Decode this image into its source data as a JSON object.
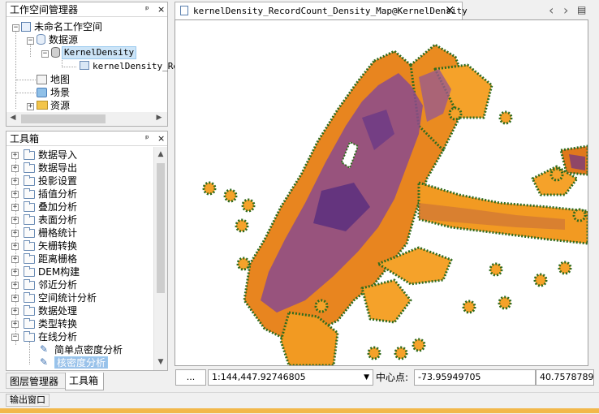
{
  "workspace_panel": {
    "title": "工作空间管理器",
    "pin": "ᵖ",
    "close": "×",
    "items": [
      {
        "label": "未命名工作空间"
      },
      {
        "label": "数据源"
      },
      {
        "label": "KernelDensity"
      },
      {
        "label": "kernelDensity_Re"
      },
      {
        "label": "地图"
      },
      {
        "label": "场景"
      },
      {
        "label": "资源"
      }
    ]
  },
  "toolbox_panel": {
    "title": "工具箱",
    "pin": "ᵖ",
    "close": "×",
    "items": [
      {
        "label": "数据导入"
      },
      {
        "label": "数据导出"
      },
      {
        "label": "投影设置"
      },
      {
        "label": "插值分析"
      },
      {
        "label": "叠加分析"
      },
      {
        "label": "表面分析"
      },
      {
        "label": "栅格统计"
      },
      {
        "label": "矢栅转换"
      },
      {
        "label": "距离栅格"
      },
      {
        "label": "DEM构建"
      },
      {
        "label": "邻近分析"
      },
      {
        "label": "空间统计分析"
      },
      {
        "label": "数据处理"
      },
      {
        "label": "类型转换"
      },
      {
        "label": "在线分析"
      },
      {
        "label": "简单点密度分析"
      },
      {
        "label": "核密度分析"
      }
    ]
  },
  "bottom_tabs": {
    "layers": "图层管理器",
    "toolbox": "工具箱"
  },
  "output_window": "输出窗口",
  "map_tab": {
    "title": "kernelDensity_RecordCount_Density_Map@KernelDensity",
    "close": "×",
    "nav_prev": "‹",
    "nav_next": "›",
    "menu": "▤"
  },
  "status": {
    "dots": "...",
    "scale": "1:144,447.92746805",
    "center_label": "中心点:",
    "center_x": "-73.95949705",
    "center_y": "40.7578789:"
  },
  "colors": {
    "selection": "#cce4f7",
    "density_low": "#f29a1c",
    "density_high": "#5b2f7e",
    "edge": "#3c6a1e"
  }
}
